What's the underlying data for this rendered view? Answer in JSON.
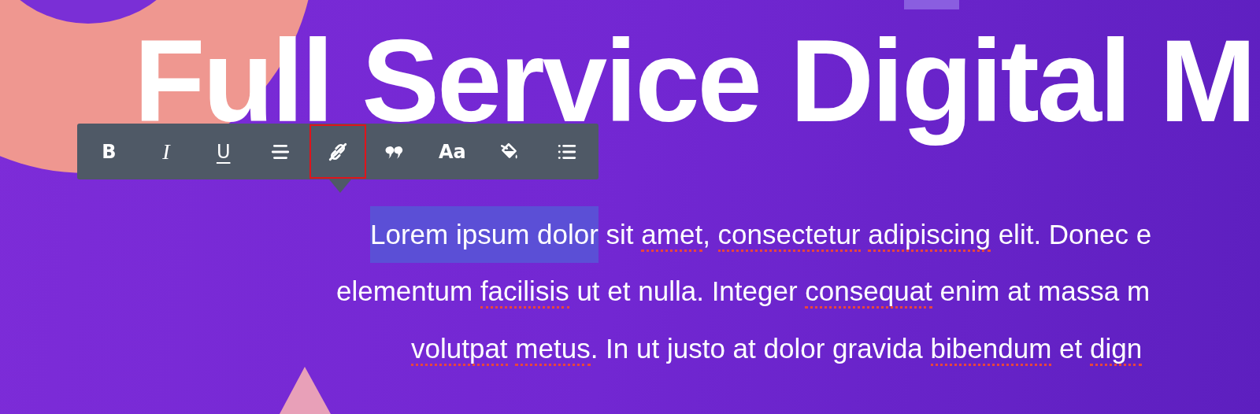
{
  "heading": "Full Service Digital M",
  "toolbar": {
    "buttons": [
      {
        "kind": "text",
        "label": "B",
        "selected": false
      },
      {
        "kind": "text",
        "label": "I",
        "selected": false
      },
      {
        "kind": "text",
        "label": "U",
        "selected": false
      },
      {
        "kind": "icon",
        "selected": false
      },
      {
        "kind": "icon",
        "selected": true
      },
      {
        "kind": "icon",
        "selected": false
      },
      {
        "kind": "text",
        "label": "Aa",
        "selected": false
      },
      {
        "kind": "icon",
        "selected": false
      },
      {
        "kind": "icon",
        "selected": false
      }
    ]
  },
  "paragraph": {
    "lines": [
      {
        "segments": [
          {
            "text": "Lorem ipsum dolor",
            "selected": true,
            "misspelled": false
          },
          {
            "text": " sit ",
            "selected": false,
            "misspelled": false
          },
          {
            "text": "amet",
            "selected": false,
            "misspelled": true
          },
          {
            "text": ", ",
            "selected": false,
            "misspelled": false
          },
          {
            "text": "consectetur",
            "selected": false,
            "misspelled": true
          },
          {
            "text": " adipiscing",
            "selected": false,
            "misspelled": true
          },
          {
            "text": " elit. Donec e",
            "selected": false,
            "misspelled": false
          }
        ]
      },
      {
        "segments": [
          {
            "text": "elementum ",
            "selected": false,
            "misspelled": false
          },
          {
            "text": "facilisis",
            "selected": false,
            "misspelled": true
          },
          {
            "text": " ut et nulla. Integer ",
            "selected": false,
            "misspelled": false
          },
          {
            "text": "consequat",
            "selected": false,
            "misspelled": true
          },
          {
            "text": " enim at massa m",
            "selected": false,
            "misspelled": false
          }
        ]
      },
      {
        "segments": [
          {
            "text": "volutpat",
            "selected": false,
            "misspelled": true
          },
          {
            "text": " metus",
            "selected": false,
            "misspelled": true
          },
          {
            "text": ". In ut justo at dolor gravida ",
            "selected": false,
            "misspelled": false
          },
          {
            "text": "bibendum",
            "selected": false,
            "misspelled": true
          },
          {
            "text": " et ",
            "selected": false,
            "misspelled": false
          },
          {
            "text": "dign",
            "selected": false,
            "misspelled": true
          }
        ]
      }
    ]
  }
}
